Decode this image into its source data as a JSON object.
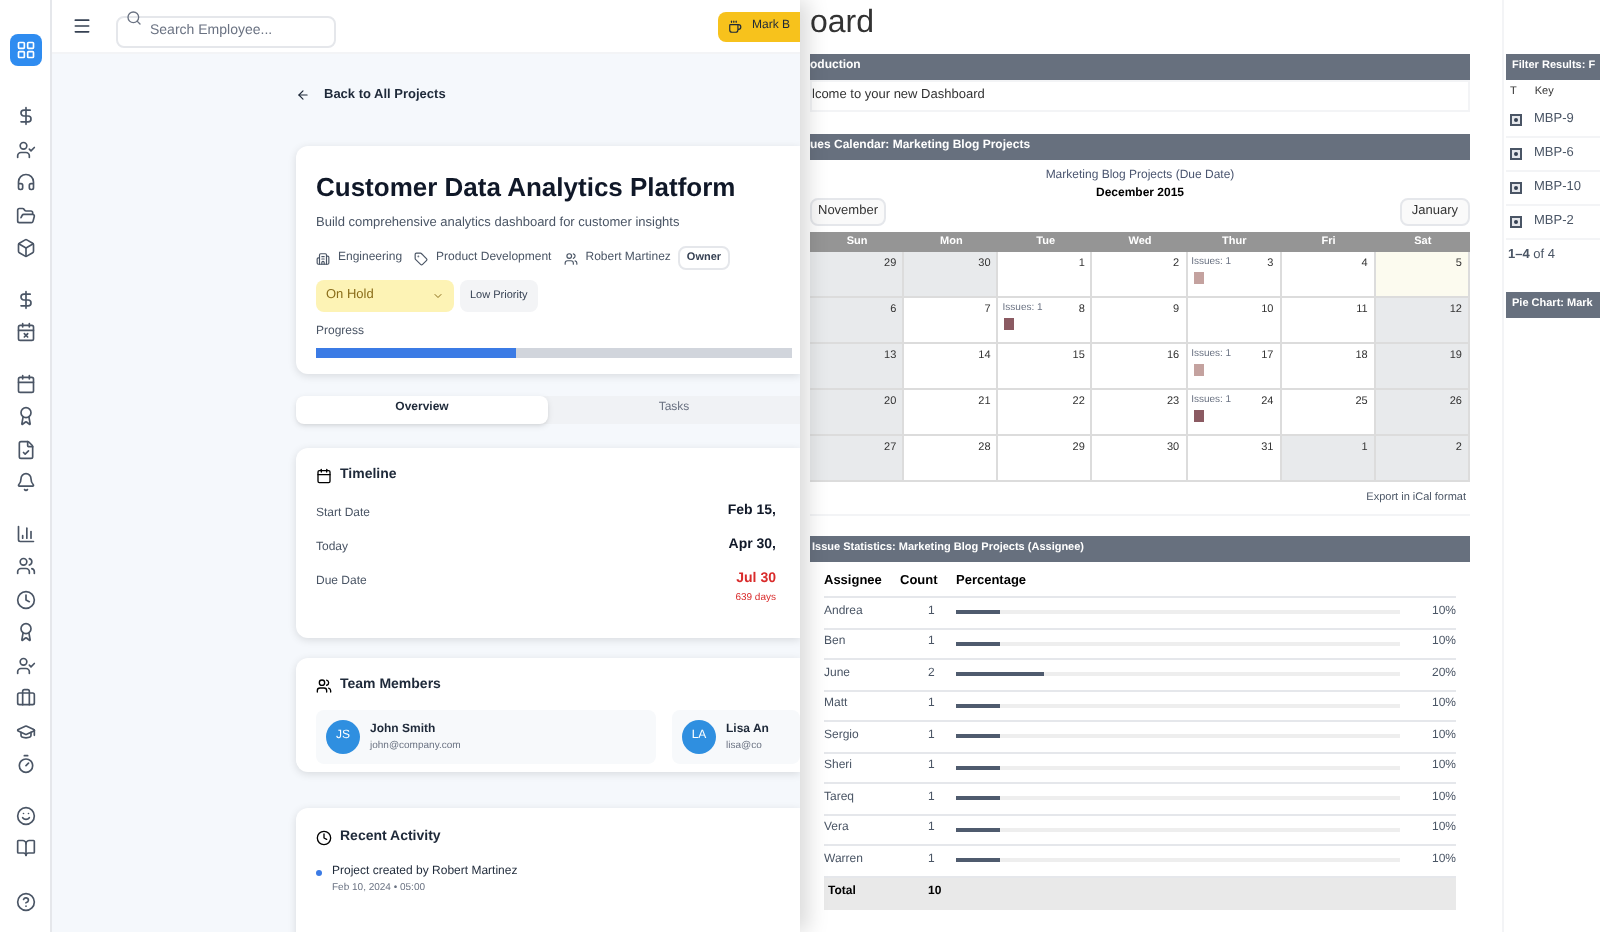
{
  "left_app": {
    "search": {
      "placeholder": "Search Employee..."
    },
    "mark_button": "Mark B",
    "back_link": "Back to All Projects",
    "project": {
      "title": "Customer Data Analytics Platform",
      "description": "Build comprehensive analytics dashboard for customer insights",
      "department": "Engineering",
      "category": "Product Development",
      "owner_name": "Robert Martinez",
      "owner_badge": "Owner",
      "status": "On Hold",
      "priority": "Low Priority",
      "progress_label": "Progress",
      "level": 0.42
    },
    "tabs": [
      {
        "label": "Overview",
        "selected": true
      },
      {
        "label": "Tasks",
        "selected": false
      }
    ],
    "timeline": {
      "title": "Timeline",
      "rows": [
        {
          "label": "Start Date",
          "value": "Feb 15,",
          "overdue": false
        },
        {
          "label": "Today",
          "value": "Apr 30,",
          "overdue": false
        },
        {
          "label": "Due Date",
          "value": "Jul 30",
          "note": "639 days",
          "overdue": true
        }
      ]
    },
    "team": {
      "title": "Team Members",
      "members": [
        {
          "initials": "JS",
          "name": "John Smith",
          "email": "john@company.com"
        },
        {
          "initials": "LA",
          "name": "Lisa An",
          "email": "lisa@co"
        }
      ]
    },
    "activity": {
      "title": "Recent Activity",
      "items": [
        {
          "text": "Project created by Robert Martinez",
          "time": "Feb 10, 2024 • 05:00"
        }
      ]
    }
  },
  "dashboard": {
    "title": "oard",
    "intro": {
      "header": "oduction",
      "text": "lcome to your new Dashboard"
    },
    "calendar": {
      "header": "ues Calendar: Marketing Blog Projects",
      "subtitle": "Marketing Blog Projects (Due Date)",
      "month": "December 2015",
      "prev": "November",
      "next": "January",
      "weekdays": [
        "Sun",
        "Mon",
        "Tue",
        "Wed",
        "Thur",
        "Fri",
        "Sat"
      ],
      "weeks": [
        [
          {
            "day": "29",
            "kind": "shaded"
          },
          {
            "day": "30",
            "kind": "shaded"
          },
          {
            "day": "1",
            "kind": "plain"
          },
          {
            "day": "2",
            "kind": "plain"
          },
          {
            "day": "3",
            "kind": "plain",
            "issues": "Issues: 1",
            "color": "#c4a29f"
          },
          {
            "day": "4",
            "kind": "plain"
          },
          {
            "day": "5",
            "kind": "today"
          }
        ],
        [
          {
            "day": "6",
            "kind": "shaded"
          },
          {
            "day": "7",
            "kind": "plain"
          },
          {
            "day": "8",
            "kind": "plain",
            "issues": "Issues: 1",
            "color": "#8b5a62"
          },
          {
            "day": "9",
            "kind": "plain"
          },
          {
            "day": "10",
            "kind": "plain"
          },
          {
            "day": "11",
            "kind": "plain"
          },
          {
            "day": "12",
            "kind": "shaded"
          }
        ],
        [
          {
            "day": "13",
            "kind": "shaded"
          },
          {
            "day": "14",
            "kind": "plain"
          },
          {
            "day": "15",
            "kind": "plain"
          },
          {
            "day": "16",
            "kind": "plain"
          },
          {
            "day": "17",
            "kind": "plain",
            "issues": "Issues: 1",
            "color": "#c4a29f"
          },
          {
            "day": "18",
            "kind": "plain"
          },
          {
            "day": "19",
            "kind": "shaded"
          }
        ],
        [
          {
            "day": "20",
            "kind": "shaded"
          },
          {
            "day": "21",
            "kind": "plain"
          },
          {
            "day": "22",
            "kind": "plain"
          },
          {
            "day": "23",
            "kind": "plain"
          },
          {
            "day": "24",
            "kind": "plain",
            "issues": "Issues: 1",
            "color": "#8b5a62"
          },
          {
            "day": "25",
            "kind": "plain"
          },
          {
            "day": "26",
            "kind": "shaded"
          }
        ],
        [
          {
            "day": "27",
            "kind": "shaded"
          },
          {
            "day": "28",
            "kind": "plain"
          },
          {
            "day": "29",
            "kind": "plain"
          },
          {
            "day": "30",
            "kind": "plain"
          },
          {
            "day": "31",
            "kind": "plain"
          },
          {
            "day": "1",
            "kind": "shaded"
          },
          {
            "day": "2",
            "kind": "shaded"
          }
        ]
      ],
      "export": "Export in iCal format"
    },
    "stats": {
      "header": "Issue Statistics: Marketing Blog Projects (Assignee)",
      "columns": [
        "Assignee",
        "Count",
        "Percentage"
      ],
      "rows": [
        {
          "name": "Andrea",
          "count": "1",
          "level": 0.1,
          "percent": "10%"
        },
        {
          "name": "Ben",
          "count": "1",
          "level": 0.1,
          "percent": "10%"
        },
        {
          "name": "June",
          "count": "2",
          "level": 0.2,
          "percent": "20%"
        },
        {
          "name": "Matt",
          "count": "1",
          "level": 0.1,
          "percent": "10%"
        },
        {
          "name": "Sergio",
          "count": "1",
          "level": 0.1,
          "percent": "10%"
        },
        {
          "name": "Sheri",
          "count": "1",
          "level": 0.1,
          "percent": "10%"
        },
        {
          "name": "Tareq",
          "count": "1",
          "level": 0.1,
          "percent": "10%"
        },
        {
          "name": "Vera",
          "count": "1",
          "level": 0.1,
          "percent": "10%"
        },
        {
          "name": "Warren",
          "count": "1",
          "level": 0.1,
          "percent": "10%"
        }
      ],
      "total_label": "Total",
      "total_count": "10"
    },
    "filter": {
      "header": "Filter Results: F",
      "columns": [
        "T",
        "Key"
      ],
      "rows": [
        "MBP-9",
        "MBP-6",
        "MBP-10",
        "MBP-2"
      ],
      "pager": "**1–4** of 4"
    },
    "pie": {
      "header": "Pie Chart: Mark"
    }
  }
}
